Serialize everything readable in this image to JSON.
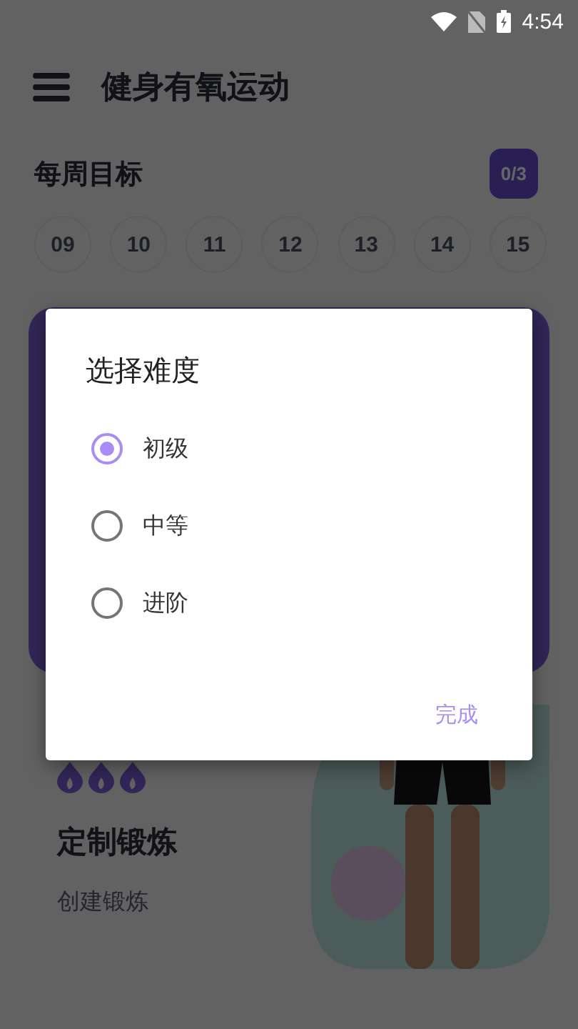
{
  "status_bar": {
    "time": "4:54"
  },
  "app_bar": {
    "title": "健身有氧运动"
  },
  "weekly_goal": {
    "title": "每周目标",
    "badge": "0/3",
    "days": [
      "09",
      "10",
      "11",
      "12",
      "13",
      "14",
      "15"
    ]
  },
  "custom_workout": {
    "title": "定制锻炼",
    "subtitle": "创建锻炼"
  },
  "dialog": {
    "title": "选择难度",
    "options": [
      {
        "label": "初级",
        "selected": true
      },
      {
        "label": "中等",
        "selected": false
      },
      {
        "label": "进阶",
        "selected": false
      }
    ],
    "confirm": "完成"
  }
}
